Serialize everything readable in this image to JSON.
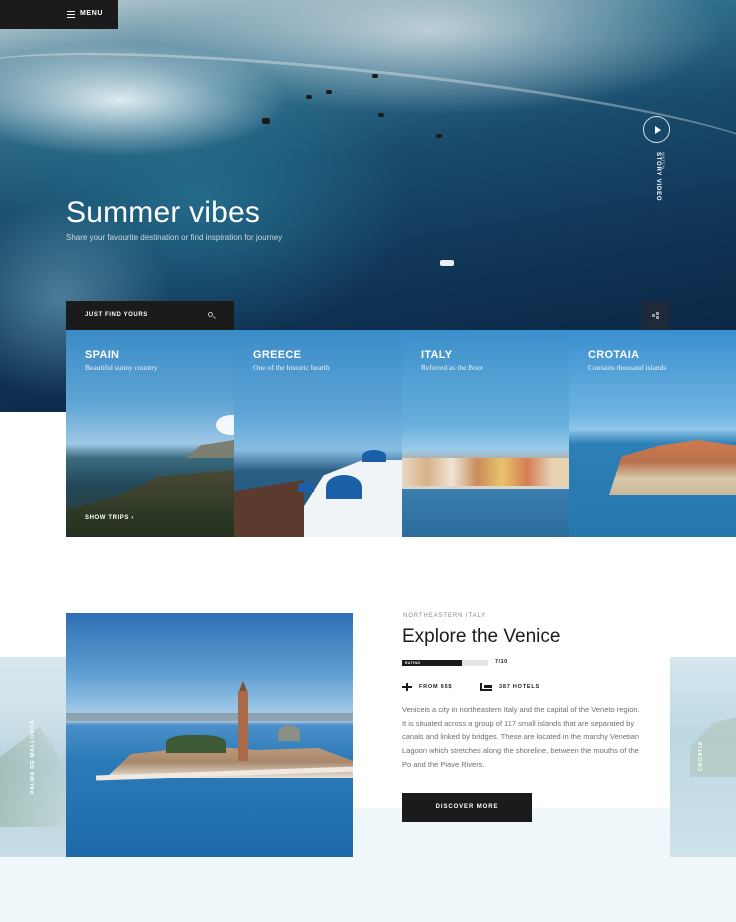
{
  "menu": {
    "label": "MENU",
    "icon": "hamburger-icon"
  },
  "hero": {
    "title": "Summer vibes",
    "subtitle": "Share your favourite destination or find inspiration for journey",
    "video": {
      "small_label": "WATCH",
      "label": "STORY VIDEO",
      "icon": "play-icon"
    }
  },
  "search": {
    "label": "JUST FIND YOURS",
    "icon": "search-icon"
  },
  "share": {
    "icon": "share-icon"
  },
  "countries": [
    {
      "name": "SPAIN",
      "description": "Beautiful sunny country",
      "action": "SHOW TRIPS"
    },
    {
      "name": "GREECE",
      "description": "One of the historic hearth"
    },
    {
      "name": "ITALY",
      "description": "Referred as the Boot"
    },
    {
      "name": "CROTAIA",
      "description": "Contains thousand islands"
    }
  ],
  "featured": {
    "kicker": "NORTHEASTERN ITALY",
    "title": "Explore the Venice",
    "rating": {
      "label": "RATING",
      "value": "7/10",
      "fraction": 0.7
    },
    "price": "FROM 65$",
    "hotels": "387 HOTELS",
    "body": "Veniceis a city in northeastern Italy and the capital of the Veneto region. It is situated across a group of 117 small islands that are separated by canals and linked by bridges. These are located in the marshy Venetian Lagoon which stretches along the shoreline, between the mouths of the Po and the Piave Rivers.",
    "button": "DISCOVER MORE",
    "side_left_label": "PALMA DE MALLORCA",
    "side_right_label": "CROATIA"
  }
}
